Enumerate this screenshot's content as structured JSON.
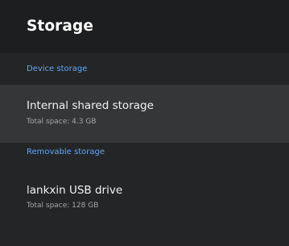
{
  "header": {
    "title": "Storage"
  },
  "sections": [
    {
      "header": "Device storage",
      "items": [
        {
          "title": "Internal shared storage",
          "subtitle": "Total space: 4.3 GB",
          "focused": true
        }
      ]
    },
    {
      "header": "Removable storage",
      "items": [
        {
          "title": "lankxin USB drive",
          "subtitle": "Total space: 128 GB",
          "focused": false
        }
      ]
    }
  ],
  "colors": {
    "background": "#242526",
    "title_bar": "#1d1e1f",
    "focused_row": "#353637",
    "accent": "#5ea8ff",
    "primary_text": "#ffffff",
    "secondary_text": "#a6a6a6"
  }
}
